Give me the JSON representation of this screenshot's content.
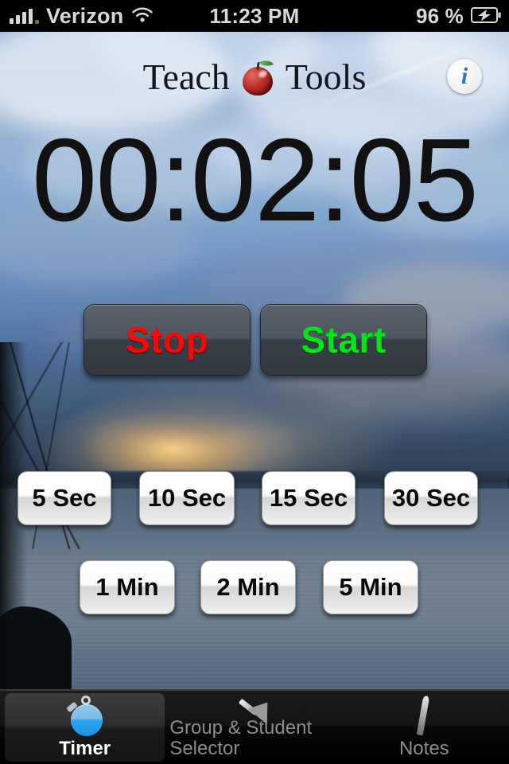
{
  "status_bar": {
    "carrier": "Verizon",
    "signal_icon": "signal-bars-icon",
    "wifi_icon": "wifi-icon",
    "time": "11:23 PM",
    "battery_percent": "96 %",
    "battery_icon": "battery-charging-icon"
  },
  "header": {
    "title_left": "Teach",
    "title_right": "Tools",
    "logo_icon": "apple-icon",
    "info_button": {
      "glyph": "i",
      "name": "info-button"
    }
  },
  "timer": {
    "display": "00:02:05",
    "hours": "00",
    "minutes": "02",
    "seconds": "05"
  },
  "controls": [
    {
      "label": "Stop",
      "color": "#ff0505",
      "name": "stop-button"
    },
    {
      "label": "Start",
      "color": "#00e617",
      "name": "start-button"
    }
  ],
  "presets": {
    "row1": [
      {
        "label": "5 Sec"
      },
      {
        "label": "10 Sec"
      },
      {
        "label": "15 Sec"
      },
      {
        "label": "30 Sec"
      }
    ],
    "row2": [
      {
        "label": "1 Min"
      },
      {
        "label": "2 Min"
      },
      {
        "label": "5 Min"
      }
    ]
  },
  "tabbar": {
    "items": [
      {
        "label": "Timer",
        "icon": "stopwatch-icon",
        "active": true
      },
      {
        "label": "Group & Student Selector",
        "icon": "arrow-pointer-icon",
        "active": false
      },
      {
        "label": "Notes",
        "icon": "pen-icon",
        "active": false
      }
    ]
  },
  "colors": {
    "accent_blue": "#2aa6ef",
    "stop_red": "#ff0505",
    "start_green": "#00e617",
    "tab_inactive": "#8c8c8c",
    "tab_active": "#ffffff"
  }
}
